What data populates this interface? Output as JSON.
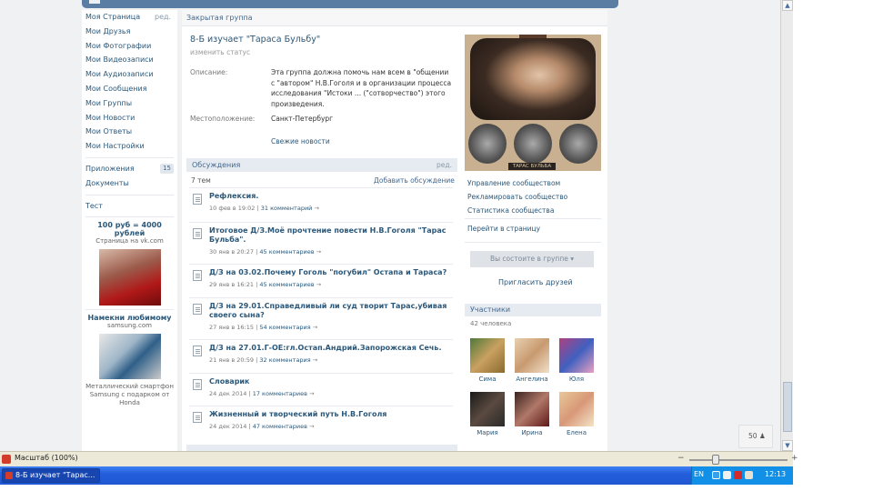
{
  "header": {
    "closed_group_label": "Закрытая группа"
  },
  "nav": {
    "edit_label": "ред.",
    "items": [
      "Моя Страница",
      "Мои Друзья",
      "Мои Фотографии",
      "Мои Видеозаписи",
      "Мои Аудиозаписи",
      "Мои Сообщения",
      "Мои Группы",
      "Мои Новости",
      "Мои Ответы",
      "Мои Настройки"
    ],
    "apps_label": "Приложения",
    "apps_count": "15",
    "documents_label": "Документы",
    "test_label": "Тест"
  },
  "ads": [
    {
      "title": "100 руб = 4000 рублей",
      "subtitle": "Страница на vk.com",
      "image": "girl-with-roses"
    },
    {
      "title": "Намекни любимому",
      "subtitle": "samsung.com",
      "image": "samsung-phone",
      "body": "Металлический смартфон Samsung с подарком от Honda"
    }
  ],
  "group": {
    "title": "8-Б изучает \"Тараса Бульбу\"",
    "status_change": "изменить статус",
    "description_label": "Описание:",
    "description": "Эта группа должна помочь нам всем в \"общении с \"автором\" Н.В.Гоголя и в организации процесса исследования \"Истоки ... (\"сотворчество\") этого произведения.",
    "location_label": "Местоположение:",
    "location": "Санкт-Петербург",
    "news_link": "Свежие новости"
  },
  "discussions": {
    "header": "Обсуждения",
    "edit_label": "ред.",
    "count": "7 тем",
    "add_label": "Добавить обсуждение",
    "topics": [
      {
        "title": "Рефлексия.",
        "date": "10 фев в 19:02",
        "comments": "31 комментарий"
      },
      {
        "title": "Итоговое Д/З.Моё прочтение повести Н.В.Гоголя \"Тарас Бульба\".",
        "date": "30 янв в 20:27",
        "comments": "45 комментариев"
      },
      {
        "title": "Д/З на 03.02.Почему Гоголь \"погубил\" Остапа и Тараса?",
        "date": "29 янв в 16:21",
        "comments": "45 комментариев"
      },
      {
        "title": "Д/З на 29.01.Справедливый ли суд творит Тарас,убивая своего сына?",
        "date": "27 янв в 16:15",
        "comments": "54 комментария"
      },
      {
        "title": "Д/З на 27.01.Г-ОЕ:гл.Остап.Андрий.Запорожская Сечь.",
        "date": "21 янв в 20:59",
        "comments": "32 комментария"
      },
      {
        "title": "Словарик",
        "date": "24 дек 2014",
        "comments": "17 комментариев"
      },
      {
        "title": "Жизненный и творческий путь Н.В.Гоголя",
        "date": "24 дек 2014",
        "comments": "47 комментариев"
      }
    ]
  },
  "sidebar_right": {
    "portrait_caption": "ТАРАС БУЛЬБА",
    "manage_label": "Управление сообществом",
    "advertise_label": "Рекламировать сообщество",
    "stats_label": "Статистика сообщества",
    "go_page_label": "Перейти в страницу",
    "status_button": "Вы состоите в группе",
    "invite_label": "Пригласить друзей",
    "members_header": "Участники",
    "members_count": "42 человека",
    "members": [
      {
        "name": "Сима"
      },
      {
        "name": "Ангелина"
      },
      {
        "name": "Юля"
      },
      {
        "name": "Мария"
      },
      {
        "name": "Ирина"
      },
      {
        "name": "Елена"
      }
    ]
  },
  "rp_widget": {
    "label": "50"
  },
  "status_bar": {
    "text": "Масштаб (100%)"
  },
  "taskbar": {
    "task_label": "8-Б изучает \"Тарас...",
    "language": "EN",
    "time": "12:13"
  },
  "colors": {
    "brand": "#597da3",
    "link": "#2b587a",
    "header_bg": "#e6ebf1",
    "taskbar": "#245edb"
  }
}
